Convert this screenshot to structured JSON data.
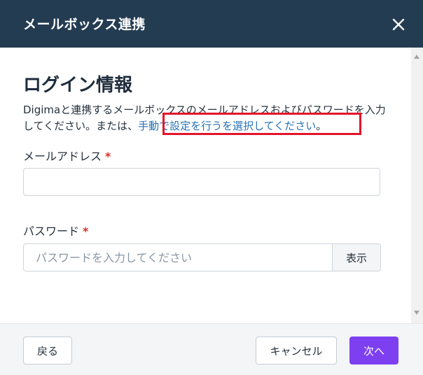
{
  "dialog": {
    "title": "メールボックス連携",
    "close_icon": "close-icon"
  },
  "content": {
    "heading": "ログイン情報",
    "description_prefix": "Digimaと連携するメールボックスのメールアドレスおよびパスワードを入力してください。または、",
    "manual_link": "手動で設定を行うを選択してください",
    "description_suffix": "。"
  },
  "form": {
    "email": {
      "label": "メールアドレス",
      "required_mark": "*",
      "value": "",
      "placeholder": ""
    },
    "password": {
      "label": "パスワード",
      "required_mark": "*",
      "value": "",
      "placeholder": "パスワードを入力してください",
      "show_label": "表示"
    }
  },
  "footer": {
    "back_label": "戻る",
    "cancel_label": "キャンセル",
    "next_label": "次へ"
  },
  "colors": {
    "header_bg": "#243c52",
    "primary": "#7d3ff0",
    "link": "#2771b5",
    "required": "#d9302c",
    "highlight": "#e2142b"
  }
}
